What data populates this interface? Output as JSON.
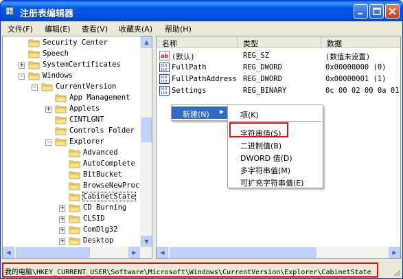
{
  "window": {
    "title": "注册表编辑器"
  },
  "menu": [
    "文件(F)",
    "编辑(E)",
    "查看(V)",
    "收藏夹(A)",
    "帮助(H)"
  ],
  "tree": [
    {
      "label": "Security Center",
      "level": 2,
      "expander": ""
    },
    {
      "label": "Speech",
      "level": 2,
      "expander": ""
    },
    {
      "label": "SystemCertificates",
      "level": 2,
      "expander": "+"
    },
    {
      "label": "Windows",
      "level": 2,
      "expander": "-"
    },
    {
      "label": "CurrentVersion",
      "level": 3,
      "expander": "-"
    },
    {
      "label": "App Management",
      "level": 4,
      "expander": ""
    },
    {
      "label": "Applets",
      "level": 4,
      "expander": "+"
    },
    {
      "label": "CINTLGNT",
      "level": 4,
      "expander": ""
    },
    {
      "label": "Controls Folder",
      "level": 4,
      "expander": ""
    },
    {
      "label": "Explorer",
      "level": 4,
      "expander": "-"
    },
    {
      "label": "Advanced",
      "level": 5,
      "expander": ""
    },
    {
      "label": "AutoComplete",
      "level": 5,
      "expander": ""
    },
    {
      "label": "BitBucket",
      "level": 5,
      "expander": ""
    },
    {
      "label": "BrowseNewProce",
      "level": 5,
      "expander": ""
    },
    {
      "label": "CabinetState",
      "level": 5,
      "expander": "",
      "selected": true
    },
    {
      "label": "CD Burning",
      "level": 5,
      "expander": "+"
    },
    {
      "label": "CLSID",
      "level": 5,
      "expander": "+"
    },
    {
      "label": "ComDlg32",
      "level": 5,
      "expander": "+"
    },
    {
      "label": "Desktop",
      "level": 5,
      "expander": "+"
    }
  ],
  "columns": {
    "name": "名称",
    "type": "类型",
    "data": "数据"
  },
  "values": [
    {
      "icon": "string-value-icon",
      "name": "(默认)",
      "type": "REG_SZ",
      "data": "(数值未设置)"
    },
    {
      "icon": "binary-value-icon",
      "name": "FullPath",
      "type": "REG_DWORD",
      "data": "0x00000000 (0)"
    },
    {
      "icon": "binary-value-icon",
      "name": "FullPathAddress",
      "type": "REG_DWORD",
      "data": "0x00000001 (1)"
    },
    {
      "icon": "binary-value-icon",
      "name": "Settings",
      "type": "REG_BINARY",
      "data": "0c 00 02 00 0a 01"
    }
  ],
  "context_menu": {
    "new_label": "新建(N)",
    "arrow": "▶"
  },
  "submenu": [
    "项(K)",
    "字符串值(S)",
    "二进制值(B)",
    "DWORD 值(D)",
    "多字符串值(M)",
    "可扩充字符串值(E)"
  ],
  "status": {
    "path": "我的电脑\\HKEY_CURRENT_USER\\Software\\Microsoft\\Windows\\CurrentVersion\\Explorer\\CabinetState"
  },
  "colors": {
    "highlight": "#316ac5",
    "annotation": "#e01010",
    "title_bar": "#0054e3"
  }
}
